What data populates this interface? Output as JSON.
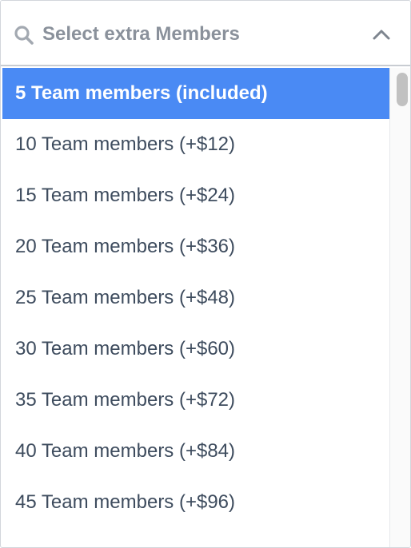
{
  "search": {
    "placeholder": "Select extra Members",
    "icon": "search-icon",
    "toggle_icon": "chevron-up-icon"
  },
  "options": [
    {
      "label": "5 Team members (included)",
      "selected": true
    },
    {
      "label": "10 Team members (+$12)",
      "selected": false
    },
    {
      "label": "15 Team members (+$24)",
      "selected": false
    },
    {
      "label": "20 Team members (+$36)",
      "selected": false
    },
    {
      "label": "25 Team members (+$48)",
      "selected": false
    },
    {
      "label": "30 Team members (+$60)",
      "selected": false
    },
    {
      "label": "35 Team members (+$72)",
      "selected": false
    },
    {
      "label": "40 Team members (+$84)",
      "selected": false
    },
    {
      "label": "45 Team members (+$96)",
      "selected": false
    }
  ],
  "colors": {
    "selected_background": "#4a8af4",
    "text": "#3e4c5e",
    "placeholder": "#8a919b"
  }
}
